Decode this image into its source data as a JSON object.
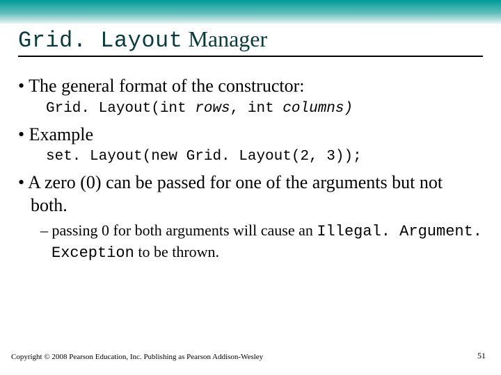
{
  "title": {
    "mono": "Grid. Layout",
    "serif": " Manager"
  },
  "bullets": {
    "b1": "The general format of the constructor:",
    "code1_a": "Grid. Layout(int ",
    "code1_b": "rows",
    "code1_c": ", int ",
    "code1_d": "columns)",
    "b2": "Example",
    "code2": "set. Layout(new Grid. Layout(2, 3));",
    "b3": "A zero (0) can be passed for one of the arguments but not both.",
    "sub1_a": "passing 0 for both arguments will cause an ",
    "sub1_b": "Illegal. Argument. Exception",
    "sub1_c": " to be thrown."
  },
  "footer": {
    "copyright": "Copyright © 2008 Pearson Education, Inc. Publishing as Pearson Addison-Wesley",
    "page": "51"
  }
}
